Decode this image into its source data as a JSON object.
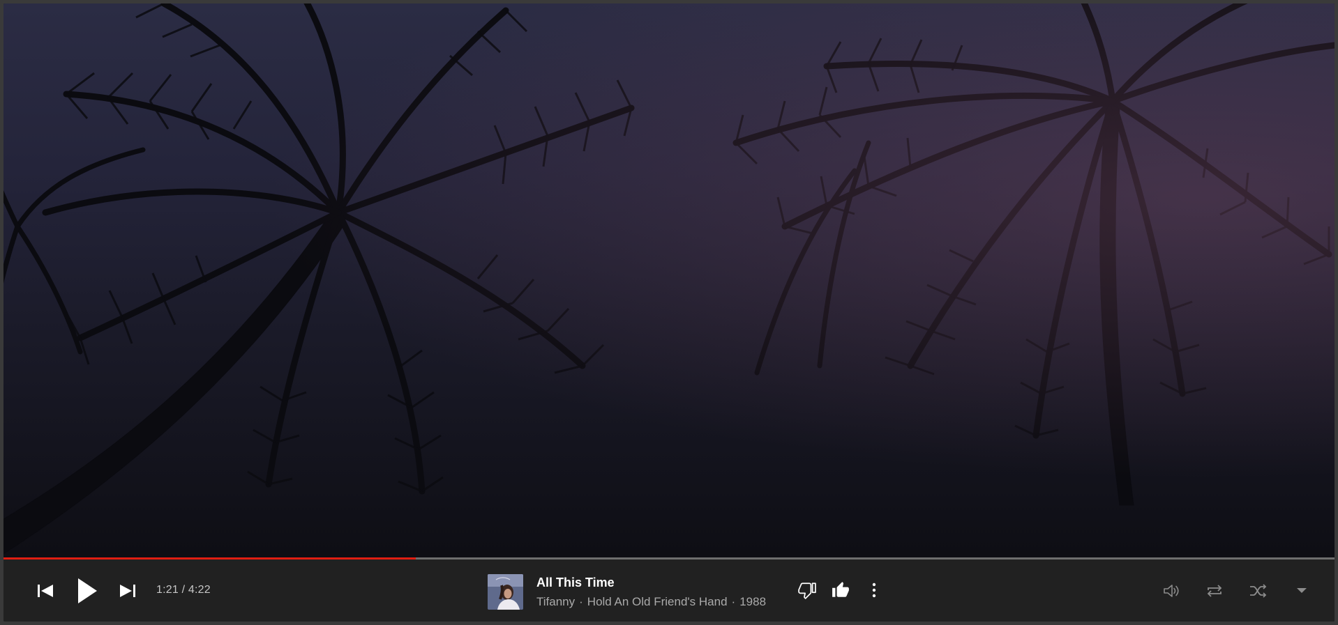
{
  "background": {
    "sky_top": "#2b2c44",
    "sky_bottom": "#0e0e14",
    "palm_color": "#0b0b10"
  },
  "playback": {
    "elapsed": "1:21",
    "separator": " / ",
    "duration": "4:22",
    "time_display": "1:21 / 4:22",
    "progress_fraction": 0.31,
    "progress_color": "#e01e12"
  },
  "track": {
    "title": "All This Time",
    "artist": "Tifanny",
    "album": "Hold An Old Friend's Hand",
    "year": "1988",
    "separator": "·",
    "artwork_icon": "album-art-thumbnail"
  },
  "controls": {
    "left": [
      {
        "name": "previous-button",
        "icon": "skip-previous-icon"
      },
      {
        "name": "play-button",
        "icon": "play-icon"
      },
      {
        "name": "next-button",
        "icon": "skip-next-icon"
      }
    ],
    "center": [
      {
        "name": "dislike-button",
        "icon": "thumb-down-icon"
      },
      {
        "name": "like-button",
        "icon": "thumb-up-icon"
      },
      {
        "name": "more-options-button",
        "icon": "more-vertical-icon"
      }
    ],
    "right": [
      {
        "name": "volume-button",
        "icon": "volume-icon"
      },
      {
        "name": "repeat-button",
        "icon": "repeat-icon"
      },
      {
        "name": "shuffle-button",
        "icon": "shuffle-icon"
      },
      {
        "name": "expand-player-button",
        "icon": "caret-down-icon"
      }
    ]
  }
}
